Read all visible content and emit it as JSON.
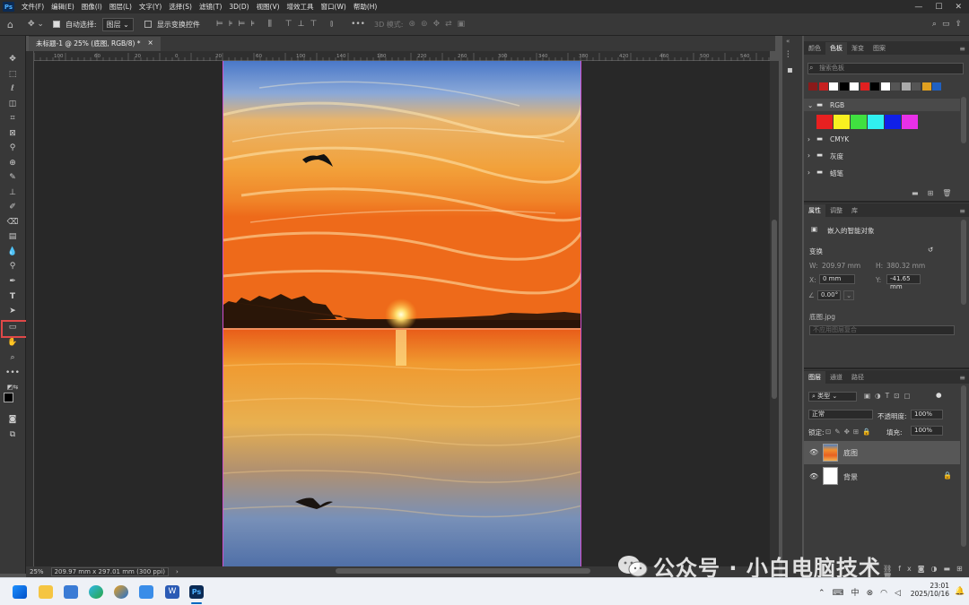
{
  "menubar": {
    "logo": "Ps",
    "items": [
      "文件(F)",
      "编辑(E)",
      "图像(I)",
      "图层(L)",
      "文字(Y)",
      "选择(S)",
      "滤镜(T)",
      "3D(D)",
      "视图(V)",
      "增效工具",
      "窗口(W)",
      "帮助(H)"
    ]
  },
  "options": {
    "auto_select_label": "自动选择:",
    "auto_select_value": "图层",
    "show_transform_label": "显示变换控件",
    "mode_3d_label": "3D 模式:"
  },
  "document": {
    "tab_title": "未标题-1 @ 25% (底图, RGB/8) *",
    "close": "×"
  },
  "ruler": {
    "ticks": [
      "100",
      "60",
      "20",
      "0",
      "20",
      "60",
      "100",
      "140",
      "180",
      "220",
      "260",
      "300",
      "340",
      "380",
      "420",
      "460",
      "500",
      "540"
    ]
  },
  "status": {
    "zoom": "25%",
    "doc_info": "209.97 mm x 297.01 mm (300 ppi)",
    "arrow": "›"
  },
  "swatches_panel": {
    "tabs": [
      "颜色",
      "色板",
      "渐变",
      "图案"
    ],
    "active_tab": "色板",
    "search_placeholder": "搜索色板",
    "recent_colors": [
      "#8a1a1a",
      "#c82020",
      "#ffffff",
      "#000000",
      "#ffffff",
      "#e02020",
      "#000000",
      "#ffffff",
      "#555555",
      "#aaaaaa",
      "#555555",
      "#e0a020",
      "#2060c0"
    ],
    "groups": [
      {
        "name": "RGB",
        "expanded": true,
        "colors": [
          "#e82020",
          "#f8f020",
          "#40e040",
          "#30f0f0",
          "#1020e8",
          "#e830e8"
        ]
      },
      {
        "name": "CMYK",
        "expanded": false
      },
      {
        "name": "灰度",
        "expanded": false
      },
      {
        "name": "蜡笔",
        "expanded": false
      }
    ]
  },
  "properties_panel": {
    "tabs": [
      "属性",
      "调整",
      "库"
    ],
    "active_tab": "属性",
    "object_type": "嵌入的智能对象",
    "transform_label": "变换",
    "w_label": "W:",
    "w_value": "209.97 mm",
    "h_label": "H:",
    "h_value": "380.32 mm",
    "x_label": "X:",
    "x_value": "0 mm",
    "y_label": "Y:",
    "y_value": "-41.65 mm",
    "angle_value": "0.00°",
    "file_name": "底图.jpg",
    "comp_placeholder": "不应用图层复合"
  },
  "layers_panel": {
    "tabs": [
      "图层",
      "通道",
      "路径"
    ],
    "active_tab": "图层",
    "filter_label": "类型",
    "blend_mode": "正常",
    "opacity_label": "不透明度:",
    "opacity_value": "100%",
    "lock_label": "锁定:",
    "fill_label": "填充:",
    "fill_value": "100%",
    "layers": [
      {
        "name": "底图",
        "selected": true
      },
      {
        "name": "背景",
        "selected": false,
        "locked": true
      }
    ]
  },
  "taskbar": {
    "time": "23:01",
    "date": "2025/10/16",
    "ime": "中"
  },
  "watermark": "公众号 · 小白电脑技术"
}
